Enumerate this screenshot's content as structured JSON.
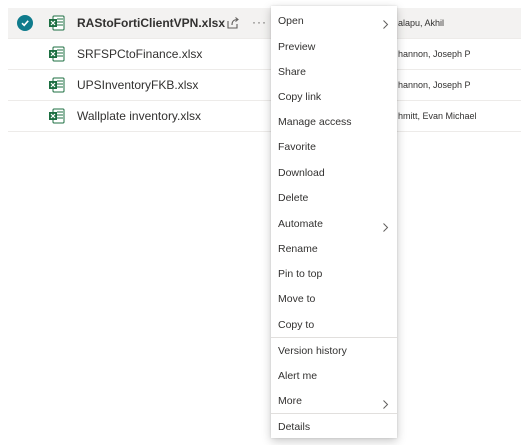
{
  "files": [
    {
      "name": "RAStoFortiClientVPN.xlsx",
      "modified_by": "alapu, Akhil",
      "selected": true
    },
    {
      "name": "SRFSPCtoFinance.xlsx",
      "modified_by": "hannon, Joseph P",
      "selected": false
    },
    {
      "name": "UPSInventoryFKB.xlsx",
      "modified_by": "hannon, Joseph P",
      "selected": false
    },
    {
      "name": "Wallplate inventory.xlsx",
      "modified_by": "hmitt, Evan Michael",
      "selected": false
    }
  ],
  "row_actions": {
    "more_label": "···",
    "share_icon": "share-icon"
  },
  "context_menu": {
    "items": [
      {
        "label": "Open",
        "submenu": true
      },
      {
        "label": "Preview"
      },
      {
        "label": "Share"
      },
      {
        "label": "Copy link"
      },
      {
        "label": "Manage access"
      },
      {
        "label": "Favorite"
      },
      {
        "label": "Download"
      },
      {
        "label": "Delete"
      },
      {
        "label": "Automate",
        "submenu": true
      },
      {
        "label": "Rename"
      },
      {
        "label": "Pin to top"
      },
      {
        "label": "Move to"
      },
      {
        "label": "Copy to"
      },
      {
        "label": "Version history"
      },
      {
        "label": "Alert me"
      },
      {
        "label": "More",
        "submenu": true
      },
      {
        "label": "Details"
      }
    ]
  },
  "colors": {
    "accent": "#0f7b8c",
    "excel_green": "#1d6f42"
  }
}
